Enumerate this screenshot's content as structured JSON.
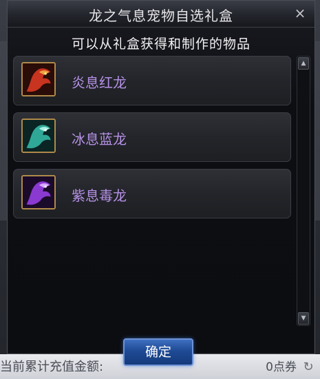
{
  "dialog": {
    "title": "龙之气息宠物自选礼盒",
    "subtitle": "可以从礼盒获得和制作的物品",
    "confirm_label": "确定",
    "close_icon": "×"
  },
  "items": [
    {
      "name": "炎息红龙",
      "color": "#e8503a"
    },
    {
      "name": "冰息蓝龙",
      "color": "#3ab8a8"
    },
    {
      "name": "紫息毒龙",
      "color": "#9b4ad8"
    }
  ],
  "background": {
    "bottom_left_text": "当前累计充值金额:",
    "bottom_right_text": "0点券",
    "refresh_icon": "↻"
  },
  "colors": {
    "item_name": "#b691e6",
    "confirm_button": "#1f4a94",
    "icon_border": "#b08a4a"
  }
}
